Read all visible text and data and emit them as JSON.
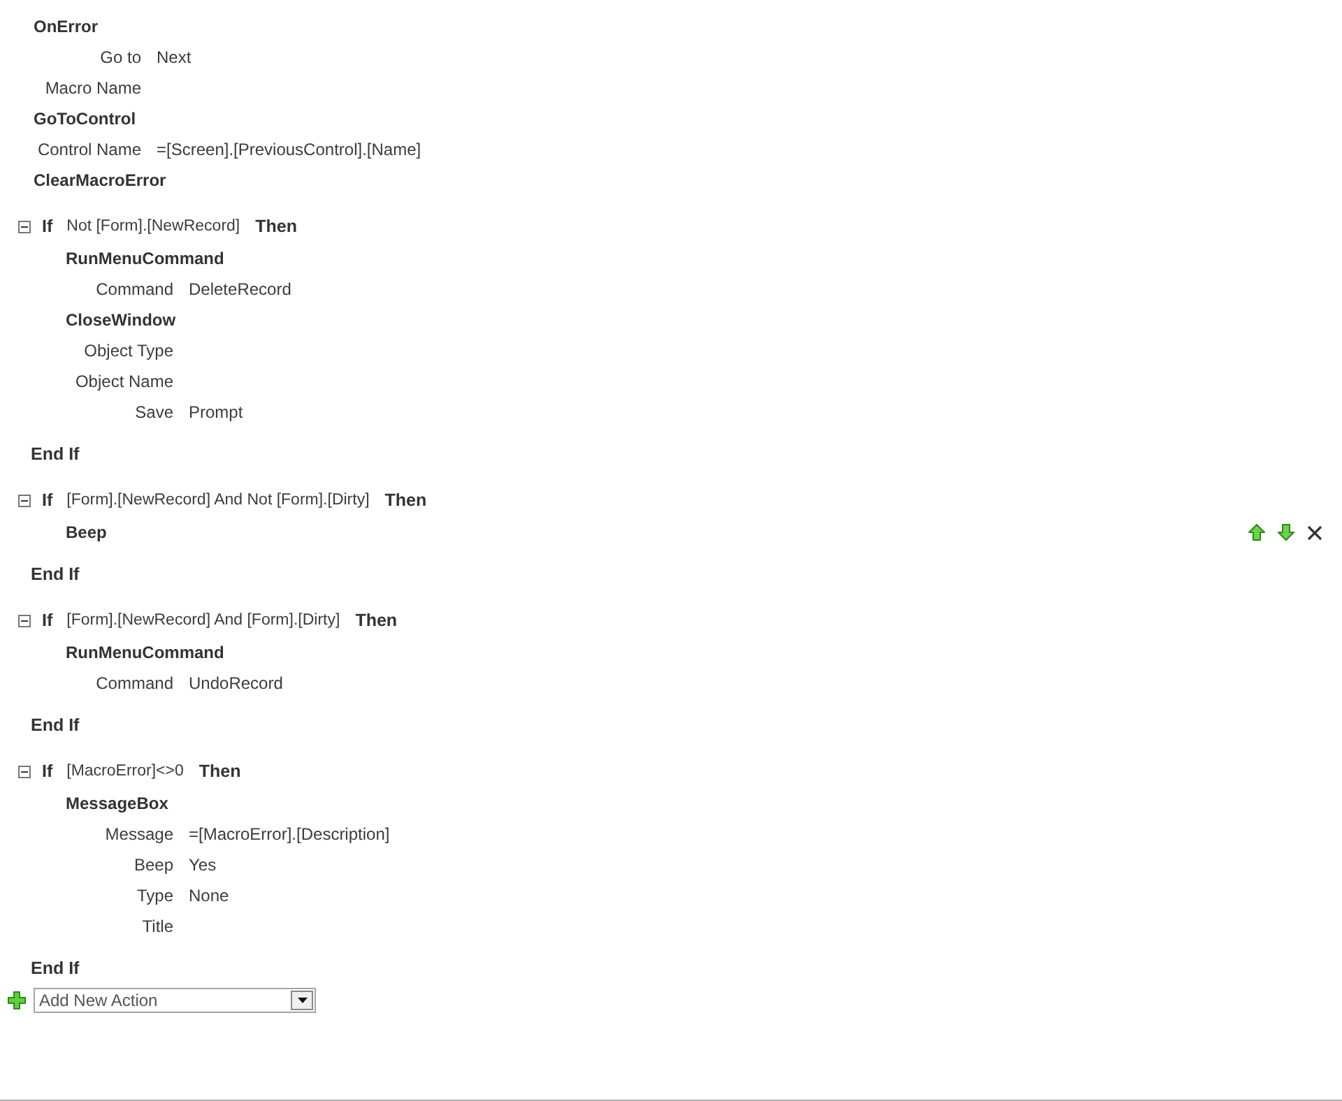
{
  "blocks": [
    {
      "kind": "action",
      "name": "OnError",
      "arguments": [
        {
          "label": "Go to",
          "value": "Next"
        },
        {
          "label": "Macro Name"
        }
      ]
    },
    {
      "kind": "action",
      "name": "GoToControl",
      "arguments": [
        {
          "label": "Control Name",
          "value": "=[Screen].[PreviousControl].[Name]"
        }
      ]
    },
    {
      "kind": "action",
      "name": "ClearMacroError"
    },
    {
      "kind": "if",
      "expanded": true,
      "keyword": "If",
      "condition": "Not [Form].[NewRecord]",
      "then": "Then",
      "end": "End If",
      "actions": [
        {
          "name": "RunMenuCommand",
          "selected": false,
          "arguments": [
            {
              "label": "Command",
              "value": "DeleteRecord"
            }
          ]
        },
        {
          "name": "CloseWindow",
          "selected": false,
          "arguments": [
            {
              "label": "Object Type"
            },
            {
              "label": "Object Name"
            },
            {
              "label": "Save",
              "value": "Prompt"
            }
          ]
        }
      ]
    },
    {
      "kind": "if",
      "expanded": true,
      "keyword": "If",
      "condition": "[Form].[NewRecord] And Not [Form].[Dirty]",
      "then": "Then",
      "end": "End If",
      "actions": [
        {
          "name": "Beep",
          "selected": true
        }
      ]
    },
    {
      "kind": "if",
      "expanded": true,
      "keyword": "If",
      "condition": "[Form].[NewRecord] And [Form].[Dirty]",
      "then": "Then",
      "end": "End If",
      "actions": [
        {
          "name": "RunMenuCommand",
          "selected": false,
          "arguments": [
            {
              "label": "Command",
              "value": "UndoRecord"
            }
          ]
        }
      ]
    },
    {
      "kind": "if",
      "expanded": true,
      "keyword": "If",
      "condition": "[MacroError]<>0",
      "then": "Then",
      "end": "End If",
      "actions": [
        {
          "name": "MessageBox",
          "selected": false,
          "arguments": [
            {
              "label": "Message",
              "value": "=[MacroError].[Description]"
            },
            {
              "label": "Beep",
              "value": "Yes"
            },
            {
              "label": "Type",
              "value": "None"
            },
            {
              "label": "Title"
            }
          ]
        }
      ]
    }
  ],
  "add_action": {
    "placeholder": "Add New Action"
  }
}
